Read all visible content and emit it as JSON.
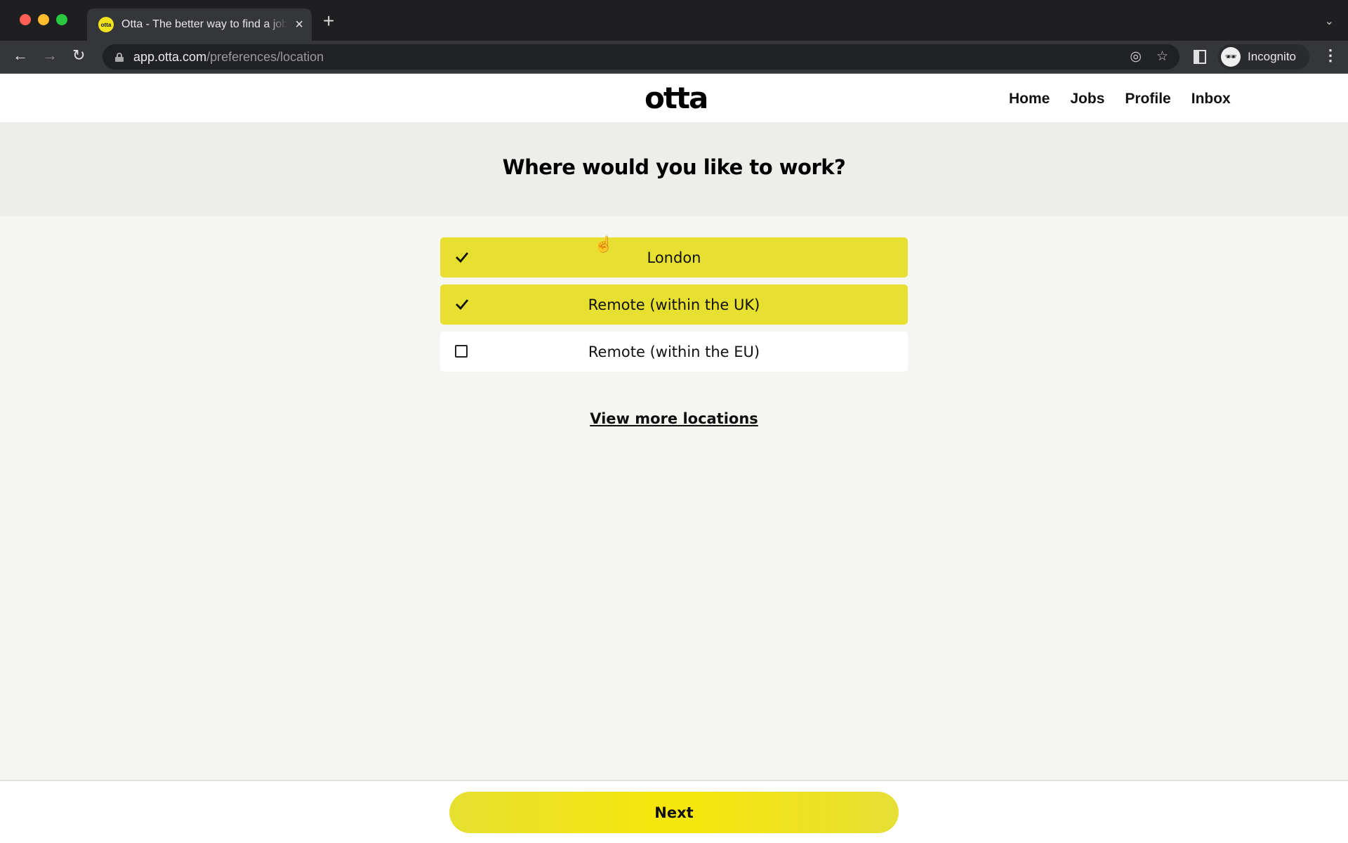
{
  "browser": {
    "tab_title": "Otta - The better way to find a job",
    "tab_favicon_text": "otta",
    "url_host": "app.otta.com",
    "url_path": "/preferences/location",
    "profile_label": "Incognito",
    "icons": {
      "back": "←",
      "forward": "→",
      "reload": "↻",
      "new_tab": "+",
      "close_tab": "×",
      "tab_search": "⌄",
      "eye_off": "◎",
      "star": "☆",
      "incognito": "🕶",
      "menu": "⋮"
    }
  },
  "site": {
    "logo": "otta",
    "nav": [
      {
        "label": "Home"
      },
      {
        "label": "Jobs"
      },
      {
        "label": "Profile"
      },
      {
        "label": "Inbox"
      }
    ]
  },
  "page": {
    "title": "Where would you like to work?",
    "options": [
      {
        "label": "London",
        "selected": true
      },
      {
        "label": "Remote (within the UK)",
        "selected": true
      },
      {
        "label": "Remote (within the EU)",
        "selected": false
      }
    ],
    "view_more_label": "View more locations",
    "next_label": "Next"
  },
  "colors": {
    "accent_yellow": "#e7e030",
    "button_yellow": "#f5e60e",
    "banner_bg": "#ededea",
    "page_bg": "#f5f5f2"
  }
}
